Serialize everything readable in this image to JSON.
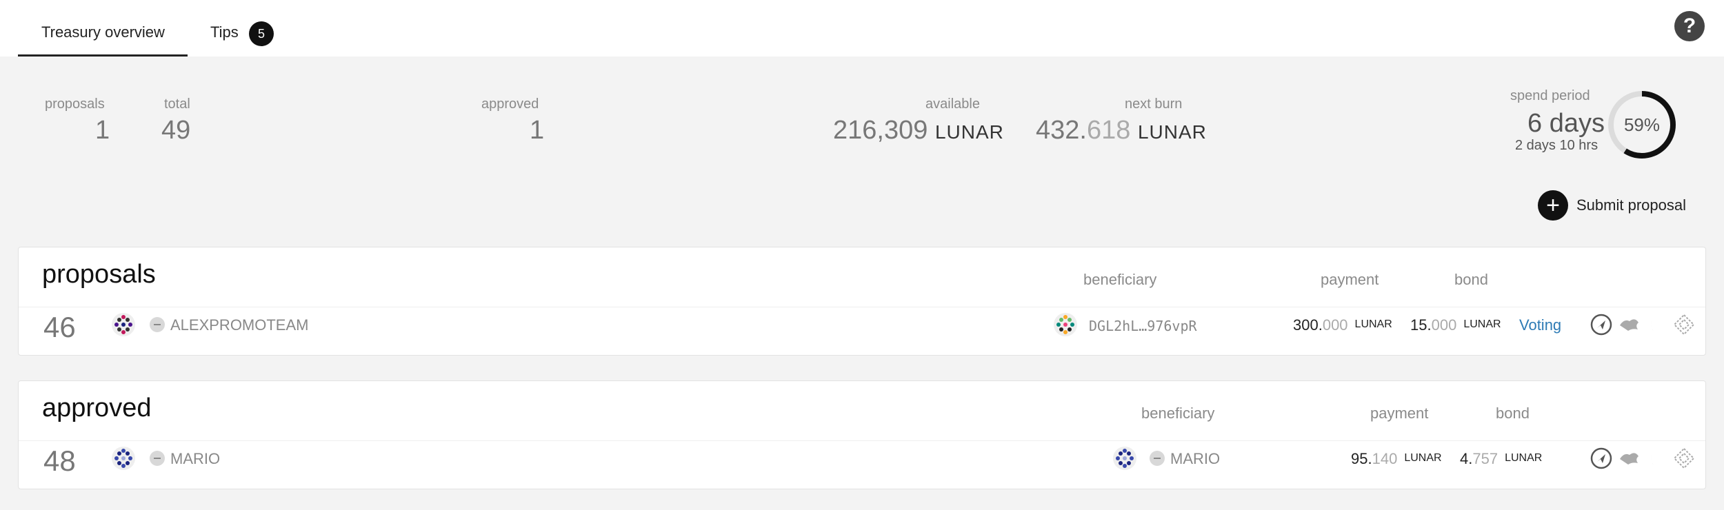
{
  "tabs": {
    "overview": "Treasury overview",
    "tips": "Tips",
    "tips_count": "5"
  },
  "help_label": "?",
  "summary": {
    "proposals_label": "proposals",
    "proposals_value": "1",
    "total_label": "total",
    "total_value": "49",
    "approved_label": "approved",
    "approved_value": "1",
    "available_label": "available",
    "available_value": "216,309",
    "available_unit": "LUNAR",
    "next_burn_label": "next burn",
    "next_burn_int": "432.",
    "next_burn_dec": "618",
    "next_burn_unit": "LUNAR",
    "spend_period_label": "spend period",
    "spend_period_days": "6 days",
    "spend_period_remaining": "2 days 10 hrs",
    "spend_period_percent": "59%",
    "spend_period_fraction": 0.59
  },
  "submit_label": "Submit proposal",
  "proposals": {
    "title": "proposals",
    "col_beneficiary": "beneficiary",
    "col_payment": "payment",
    "col_bond": "bond",
    "rows": [
      {
        "id": "46",
        "proposer": "ALEXPROMOTEAM",
        "beneficiary": "DGL2hL…976vpR",
        "payment_int": "300.",
        "payment_dec": "000",
        "payment_unit": "LUNAR",
        "bond_int": "15.",
        "bond_dec": "000",
        "bond_unit": "LUNAR",
        "status": "Voting"
      }
    ]
  },
  "approved": {
    "title": "approved",
    "col_beneficiary": "beneficiary",
    "col_payment": "payment",
    "col_bond": "bond",
    "rows": [
      {
        "id": "48",
        "proposer": "MARIO",
        "beneficiary": "MARIO",
        "payment_int": "95.",
        "payment_dec": "140",
        "payment_unit": "LUNAR",
        "bond_int": "4.",
        "bond_dec": "757",
        "bond_unit": "LUNAR"
      }
    ]
  },
  "colors": {
    "accent": "#111111",
    "status_link": "#2e7bb5",
    "muted": "#8a8a8a"
  },
  "icons": [
    "polkascan-icon",
    "subscan-icon",
    "commonwealth-icon",
    "polkassembly-icon"
  ]
}
